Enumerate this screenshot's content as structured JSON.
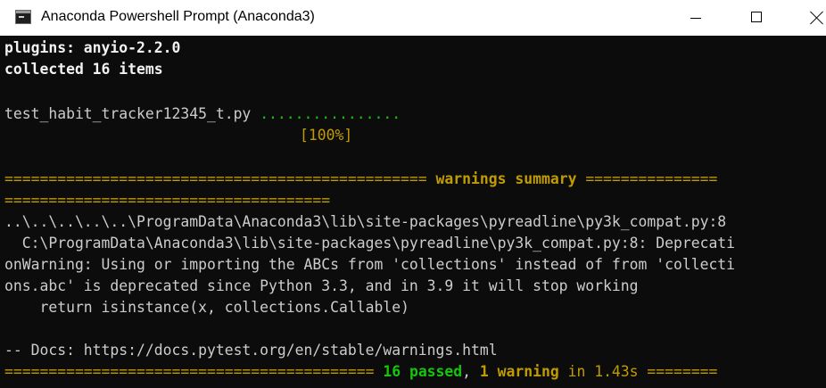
{
  "window": {
    "title": "Anaconda Powershell Prompt (Anaconda3)",
    "icon": "console-app-icon",
    "buttons": [
      "minimize-icon",
      "maximize-icon",
      "close-icon"
    ]
  },
  "console": {
    "plugins": "plugins: anyio-2.2.0",
    "collected": "collected 16 items",
    "test_file": "test_habit_tracker12345_t.py",
    "test_dots": "................",
    "progress": "[100%]",
    "warn_sep_left": "================================================",
    "warn_title": "warnings summary",
    "warn_sep_right": "===============",
    "warn_sep_line2": "=====================================",
    "warn_path": "..\\..\\..\\..\\..\\ProgramData\\Anaconda3\\lib\\site-packages\\pyreadline\\py3k_compat.py:8",
    "warn_msg_1": "  C:\\ProgramData\\Anaconda3\\lib\\site-packages\\pyreadline\\py3k_compat.py:8: Deprecati",
    "warn_msg_2": "onWarning: Using or importing the ABCs from 'collections' instead of from 'collecti",
    "warn_msg_3": "ons.abc' is deprecated since Python 3.3, and in 3.9 it will stop working",
    "warn_code": "    return isinstance(x, collections.Callable)",
    "docs": "-- Docs: https://docs.pytest.org/en/stable/warnings.html",
    "final_sep_left": "==========================================",
    "passed": "16 passed",
    "comma": ",",
    "warning_count": "1 warning",
    "duration": "in 1.43s",
    "final_sep_right": "========"
  },
  "colors": {
    "background": "#0c0c0c",
    "text": "#cccccc",
    "green": "#16c60c",
    "yellow": "#c19c00"
  }
}
